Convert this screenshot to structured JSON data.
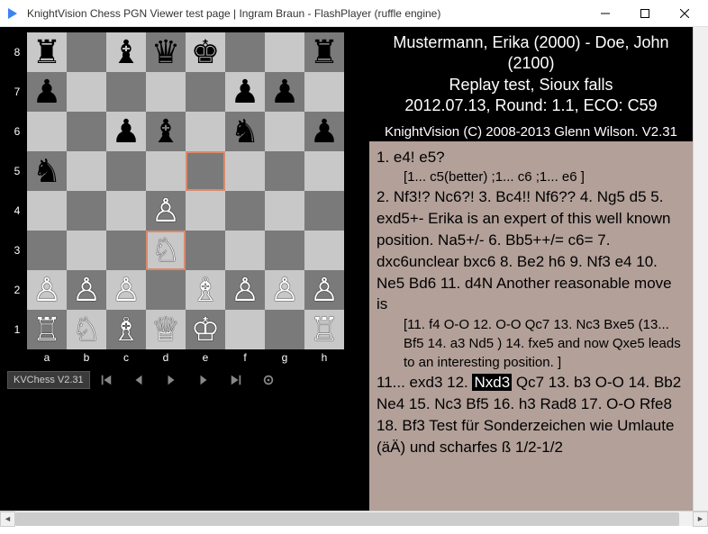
{
  "window": {
    "title": "KnightVision Chess PGN Viewer test page | Ingram Braun - FlashPlayer (ruffle engine)"
  },
  "game_header": {
    "players": "Mustermann, Erika (2000) - Doe, John (2100)",
    "event": "Replay test, Sioux falls",
    "meta": "2012.07.13, Round: 1.1, ECO: C59"
  },
  "copyright": "KnightVision (C) 2008-2013 Glenn Wilson. V2.31",
  "moves": {
    "line1": "1.  e4! e5?",
    "var1": "[1...  c5(better) ;1...  c6 ;1...  e6 ]",
    "line2": "2.  Nf3!? Nc6?! 3.  Bc4!! Nf6?? 4.  Ng5 d5 5.  exd5+- Erika is an expert of this well known position. Na5+/- 6.  Bb5++/= c6= 7.  dxc6unclear bxc6 8.  Be2 h6 9.  Nf3 e4 10.  Ne5 Bd6 11.  d4N Another reasonable move is",
    "var2": "[11.  f4 O-O 12.  O-O Qc7 13.  Nc3 Bxe5 (13...  Bf5 14.  a3 Nd5 ) 14.  fxe5 and now Qxe5 leads to an interesting position. ]",
    "line3a": "11...  exd3 12.  ",
    "highlight": "Nxd3",
    "line3b": " Qc7 13.  b3 O-O 14.  Bb2 Ne4 15.  Nc3 Bf5 16.  h3 Rad8 17.  O-O Rfe8 18.  Bf3  Test für Sonderzeichen wie Umlaute (äÄ) und scharfes ß 1/2-1/2"
  },
  "board": {
    "files": [
      "a",
      "b",
      "c",
      "d",
      "e",
      "f",
      "g",
      "h"
    ],
    "ranks": [
      "8",
      "7",
      "6",
      "5",
      "4",
      "3",
      "2",
      "1"
    ],
    "highlighted": [
      "e5",
      "d3"
    ],
    "position": {
      "a8": "br",
      "c8": "bb",
      "d8": "bq",
      "e8": "bk",
      "h8": "br",
      "a7": "bp",
      "f7": "bp",
      "g7": "bp",
      "c6": "bp",
      "d6": "bb",
      "f6": "bn",
      "h6": "bp",
      "a5": "bn",
      "d4": "wp",
      "d3": "wn",
      "a2": "wp",
      "b2": "wp",
      "c2": "wp",
      "e2": "wb",
      "f2": "wp",
      "g2": "wp",
      "h2": "wp",
      "a1": "wr",
      "b1": "wn",
      "c1": "wb",
      "d1": "wq",
      "e1": "wk",
      "h1": "wr"
    }
  },
  "controls": {
    "version": "KVChess V2.31"
  },
  "piece_glyph": {
    "wk": "♔",
    "wq": "♕",
    "wr": "♖",
    "wb": "♗",
    "wn": "♘",
    "wp": "♙",
    "bk": "♚",
    "bq": "♛",
    "br": "♜",
    "bb": "♝",
    "bn": "♞",
    "bp": "♟"
  }
}
